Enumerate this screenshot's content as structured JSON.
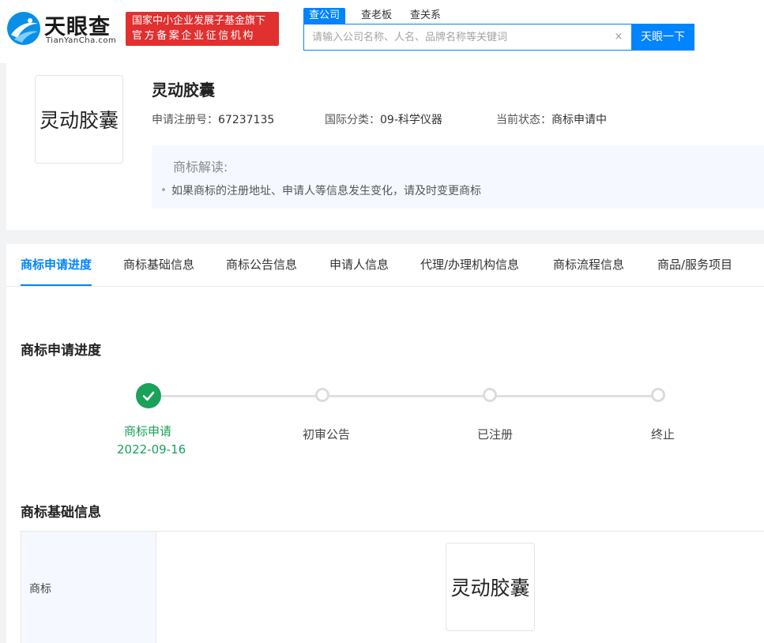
{
  "header": {
    "logo_cn": "天眼查",
    "logo_en": "TianYanCha.com",
    "badge_line1": "国家中小企业发展子基金旗下",
    "badge_line2": "官方备案企业征信机构",
    "search_tabs": [
      "查公司",
      "查老板",
      "查关系"
    ],
    "search_placeholder": "请输入公司名称、人名、品牌名称等关键词",
    "clear_symbol": "×",
    "search_button": "天眼一下"
  },
  "trademark": {
    "image_text": "灵动胶囊",
    "name": "灵动胶囊",
    "reg_no_label": "申请注册号：",
    "reg_no": "67237135",
    "intl_class_label": "国际分类：",
    "intl_class": "09-科学仪器",
    "status_label": "当前状态：",
    "status": "商标申请中",
    "interp_title": "商标解读:",
    "interp_item": "如果商标的注册地址、申请人等信息发生变化，请及时变更商标"
  },
  "nav_tabs": [
    "商标申请进度",
    "商标基础信息",
    "商标公告信息",
    "申请人信息",
    "代理/办理机构信息",
    "商标流程信息",
    "商品/服务项目"
  ],
  "progress": {
    "title": "商标申请进度",
    "steps": [
      {
        "label": "商标申请",
        "date": "2022-09-16"
      },
      {
        "label": "初审公告"
      },
      {
        "label": "已注册"
      },
      {
        "label": "终止"
      }
    ],
    "colors": {
      "done": "#1aa15a",
      "pending": "#dcdcdc"
    }
  },
  "basic_info": {
    "title": "商标基础信息",
    "row_label": "商标",
    "image_text": "灵动胶囊"
  },
  "colors": {
    "accent": "#0084ff",
    "badge": "#e03030"
  }
}
